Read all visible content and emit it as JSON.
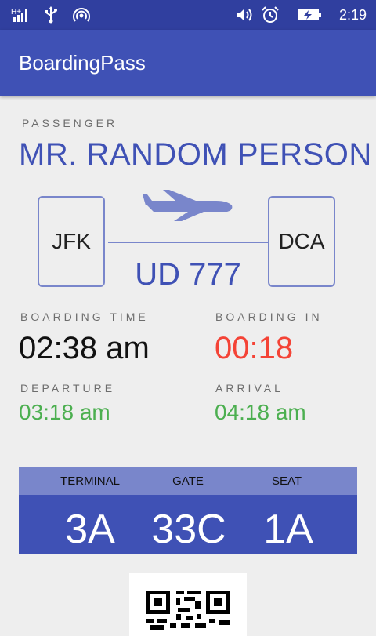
{
  "status_bar": {
    "time": "2:19",
    "icons": [
      "h-plus-signal-icon",
      "usb-icon",
      "hotspot-icon",
      "vibrate-icon",
      "alarm-icon",
      "battery-charging-icon"
    ]
  },
  "app_bar": {
    "title": "BoardingPass"
  },
  "passenger": {
    "label": "PASSENGER",
    "name": "MR. RANDOM PERSON"
  },
  "route": {
    "origin": "JFK",
    "destination": "DCA",
    "flight_number": "UD 777",
    "icon": "airplane-icon"
  },
  "boarding_time": {
    "label": "BOARDING TIME",
    "value": "02:38 am"
  },
  "boarding_in": {
    "label": "BOARDING IN",
    "value": "00:18",
    "color": "#f44336"
  },
  "departure": {
    "label": "DEPARTURE",
    "value": "03:18 am",
    "color": "#4caf50"
  },
  "arrival": {
    "label": "ARRIVAL",
    "value": "04:18 am",
    "color": "#4caf50"
  },
  "info": {
    "terminal_label": "TERMINAL",
    "terminal": "3A",
    "gate_label": "GATE",
    "gate": "33C",
    "seat_label": "SEAT",
    "seat": "1A"
  },
  "colors": {
    "primary": "#3f51b5",
    "primary_dark": "#303f9f",
    "accent_light": "#7986cb"
  },
  "qr": {
    "icon": "qr-code-icon"
  }
}
